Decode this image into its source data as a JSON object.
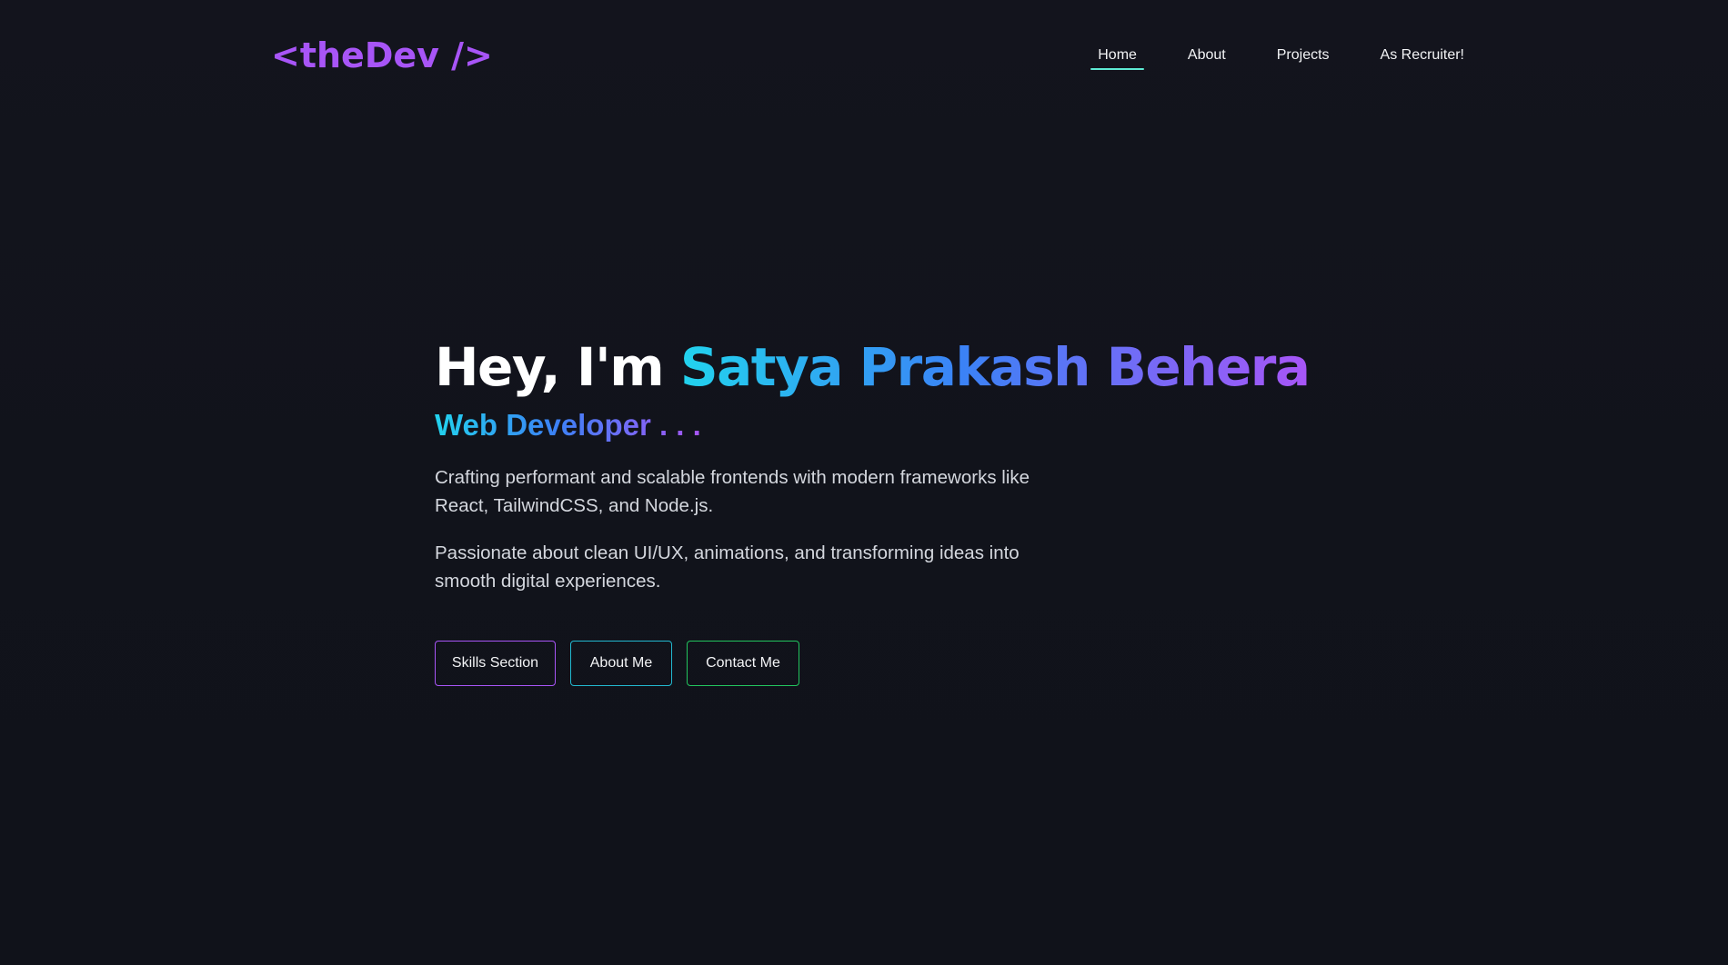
{
  "navbar": {
    "logo": "<theDev />",
    "links": [
      {
        "label": "Home",
        "active": true
      },
      {
        "label": "About",
        "active": false
      },
      {
        "label": "Projects",
        "active": false
      },
      {
        "label": "As Recruiter!",
        "active": false
      }
    ]
  },
  "hero": {
    "greeting": "Hey, I'm ",
    "name": "Satya Prakash Behera",
    "role": "Web Developer . . .",
    "paragraph_1": "Crafting performant and scalable frontends with modern frameworks like React, TailwindCSS, and Node.js.",
    "paragraph_2": "Passionate about clean UI/UX, animations, and transforming ideas into smooth digital experiences.",
    "buttons": {
      "skills": "Skills Section",
      "about": "About Me",
      "contact": "Contact Me"
    }
  },
  "colors": {
    "background": "#11131b",
    "brand_purple": "#a855f7",
    "gradient_start": "#22d3ee",
    "gradient_mid": "#3b82f6",
    "gradient_end": "#a855f7",
    "active_underline": "#5eead4",
    "skills_border": "#a855f7",
    "about_border": "#22b8cf",
    "contact_border": "#22c55e"
  }
}
